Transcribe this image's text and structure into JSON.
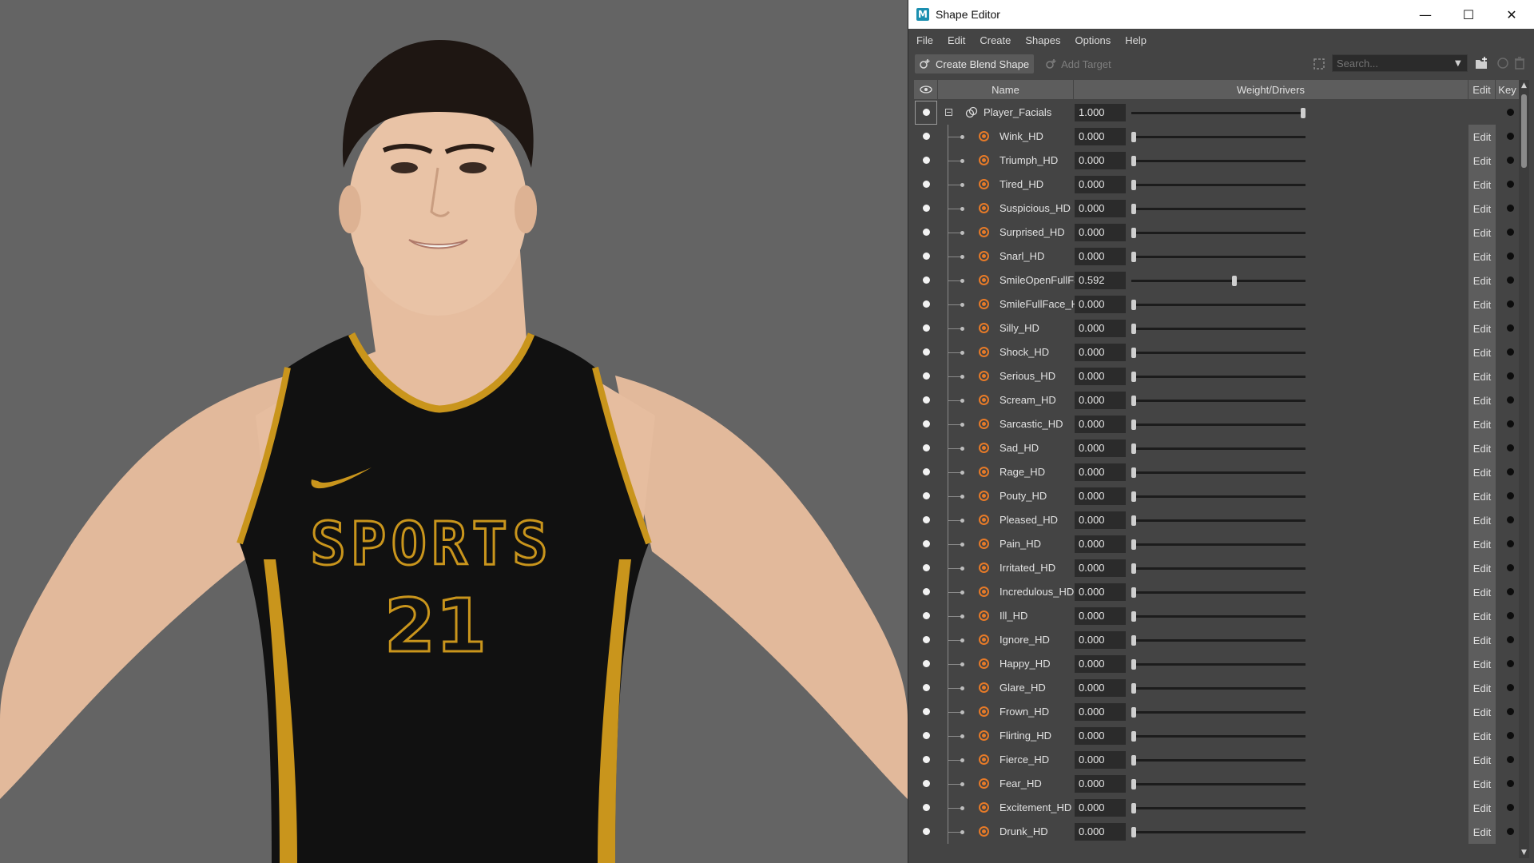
{
  "window": {
    "title": "Shape Editor",
    "app_icon_letter": "M",
    "controls": [
      "minimize-icon",
      "maximize-icon",
      "close-icon"
    ]
  },
  "menu": [
    "File",
    "Edit",
    "Create",
    "Shapes",
    "Options",
    "Help"
  ],
  "toolbar": {
    "create_blend_shape": "Create Blend Shape",
    "add_target": "Add Target",
    "search_placeholder": "Search..."
  },
  "columns": {
    "name": "Name",
    "weight": "Weight/Drivers",
    "edit": "Edit",
    "key": "Key"
  },
  "jersey": {
    "brand_text": "SPORTS",
    "number": "21"
  },
  "colors": {
    "target_icon": "#e67a28",
    "jersey": "#111111",
    "trim": "#c9951c",
    "panel_bg": "#444444"
  },
  "blend_shape": {
    "name": "Player_Facials",
    "weight": "1.000",
    "slider": 1.0
  },
  "targets": [
    {
      "name": "Wink_HD",
      "weight": "0.000",
      "slider": 0.0
    },
    {
      "name": "Triumph_HD",
      "weight": "0.000",
      "slider": 0.0
    },
    {
      "name": "Tired_HD",
      "weight": "0.000",
      "slider": 0.0
    },
    {
      "name": "Suspicious_HD",
      "weight": "0.000",
      "slider": 0.0
    },
    {
      "name": "Surprised_HD",
      "weight": "0.000",
      "slider": 0.0
    },
    {
      "name": "Snarl_HD",
      "weight": "0.000",
      "slider": 0.0
    },
    {
      "name": "SmileOpenFullFa",
      "weight": "0.592",
      "slider": 0.592
    },
    {
      "name": "SmileFullFace_H",
      "weight": "0.000",
      "slider": 0.0
    },
    {
      "name": "Silly_HD",
      "weight": "0.000",
      "slider": 0.0
    },
    {
      "name": "Shock_HD",
      "weight": "0.000",
      "slider": 0.0
    },
    {
      "name": "Serious_HD",
      "weight": "0.000",
      "slider": 0.0
    },
    {
      "name": "Scream_HD",
      "weight": "0.000",
      "slider": 0.0
    },
    {
      "name": "Sarcastic_HD",
      "weight": "0.000",
      "slider": 0.0
    },
    {
      "name": "Sad_HD",
      "weight": "0.000",
      "slider": 0.0
    },
    {
      "name": "Rage_HD",
      "weight": "0.000",
      "slider": 0.0
    },
    {
      "name": "Pouty_HD",
      "weight": "0.000",
      "slider": 0.0
    },
    {
      "name": "Pleased_HD",
      "weight": "0.000",
      "slider": 0.0
    },
    {
      "name": "Pain_HD",
      "weight": "0.000",
      "slider": 0.0
    },
    {
      "name": "Irritated_HD",
      "weight": "0.000",
      "slider": 0.0
    },
    {
      "name": "Incredulous_HD",
      "weight": "0.000",
      "slider": 0.0
    },
    {
      "name": "Ill_HD",
      "weight": "0.000",
      "slider": 0.0
    },
    {
      "name": "Ignore_HD",
      "weight": "0.000",
      "slider": 0.0
    },
    {
      "name": "Happy_HD",
      "weight": "0.000",
      "slider": 0.0
    },
    {
      "name": "Glare_HD",
      "weight": "0.000",
      "slider": 0.0
    },
    {
      "name": "Frown_HD",
      "weight": "0.000",
      "slider": 0.0
    },
    {
      "name": "Flirting_HD",
      "weight": "0.000",
      "slider": 0.0
    },
    {
      "name": "Fierce_HD",
      "weight": "0.000",
      "slider": 0.0
    },
    {
      "name": "Fear_HD",
      "weight": "0.000",
      "slider": 0.0
    },
    {
      "name": "Excitement_HD",
      "weight": "0.000",
      "slider": 0.0
    },
    {
      "name": "Drunk_HD",
      "weight": "0.000",
      "slider": 0.0
    }
  ]
}
